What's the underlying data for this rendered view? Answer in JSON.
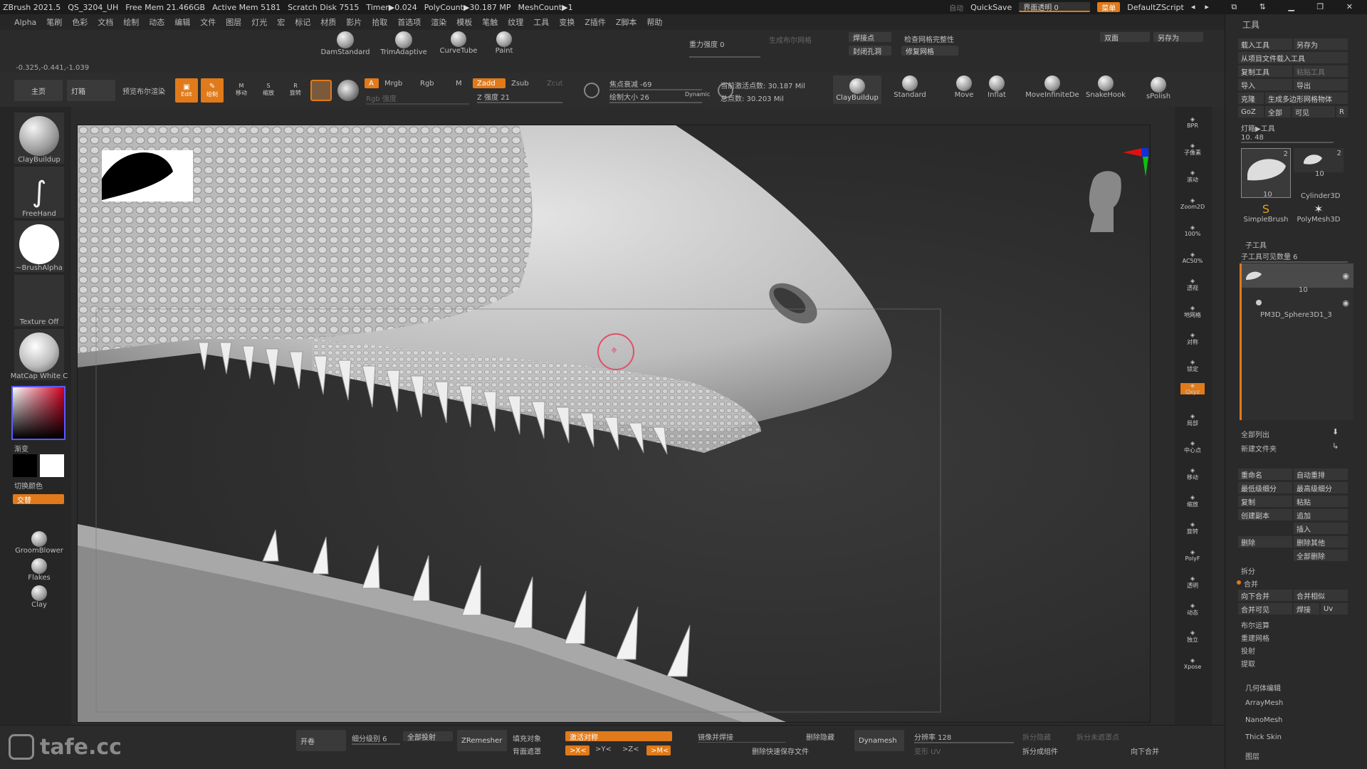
{
  "titlebar": {
    "app": "ZBrush 2021.5",
    "file": "QS_3204_UH",
    "free_mem": "Free Mem 21.466GB",
    "active_mem": "Active Mem 5181",
    "scratch": "Scratch Disk 7515",
    "timer": "Timer▶0.024",
    "polycount": "PolyCount▶30.187 MP",
    "meshcount": "MeshCount▶1",
    "autosave": "自动",
    "quicksave": "QuickSave",
    "ui_opacity": "界面透明 0",
    "menu_btn": "菜单",
    "script": "DefaultZScript"
  },
  "menubar": [
    "Alpha",
    "笔刷",
    "色彩",
    "文档",
    "绘制",
    "动态",
    "编辑",
    "文件",
    "图层",
    "灯光",
    "宏",
    "标记",
    "材质",
    "影片",
    "拾取",
    "首选项",
    "渲染",
    "模板",
    "笔触",
    "纹理",
    "工具",
    "变换",
    "Z插件",
    "Z脚本",
    "帮助"
  ],
  "coords": "-0.325,-0.441,-1.039",
  "top_brushes": [
    "DamStandard",
    "TrimAdaptive",
    "CurveTube",
    "Paint"
  ],
  "gravity": "重力强度 0",
  "top_right_btns": [
    "生成布尔网格",
    "焊接点",
    "检查网格完整性",
    "封闭孔洞",
    "修复网格",
    "双面",
    "另存为"
  ],
  "toolbar2": {
    "home": "主页",
    "lightbox": "灯箱",
    "preview_boolean": "预览布尔渲染",
    "edit": "Edit",
    "draw": "绘制",
    "move": "移动",
    "scale": "缩放",
    "rotate": "旋转",
    "a": "A",
    "mrgb": "Mrgb",
    "rgb": "Rgb",
    "m": "M",
    "rgb_intensity": "Rgb 强度",
    "zadd": "Zadd",
    "zsub": "Zsub",
    "zcut": "Zcut",
    "z_intensity": "Z 强度 21",
    "focal": "焦点衰减 -69",
    "draw_size": "绘制大小 26",
    "dynamic": "Dynamic",
    "active_points": "当前激活点数: 30.187 Mil",
    "total_points": "总点数: 30.203 Mil",
    "brushes": [
      "ClayBuildup",
      "Standard",
      "Move",
      "Inflat",
      "MoveInfiniteDe",
      "SnakeHook",
      "sPolish"
    ]
  },
  "leftshelf": {
    "brush": "ClayBuildup",
    "stroke": "FreeHand",
    "alpha": "~BrushAlpha",
    "texture": "Texture Off",
    "material": "MatCap White C",
    "gradient": "渐变",
    "switch_color": "切换颜色",
    "alternate": "交替",
    "brushes2": [
      "GroomBlower",
      "Flakes",
      "Clay"
    ]
  },
  "rightshelf": [
    "BPR",
    "子像素",
    "滚动",
    "Zoom2D",
    "100%",
    "AC50%",
    "透视",
    "地网格",
    "对称",
    "锁定",
    "Qxyz",
    "局部",
    "中心点",
    "移动",
    "缩放",
    "旋转",
    "PolyF",
    "透明",
    "动态",
    "独立",
    "Xpose"
  ],
  "toolpanel": {
    "title": "工具",
    "load": "载入工具",
    "save_as": "另存为",
    "load_project": "从项目文件载入工具",
    "copy_tool": "复制工具",
    "paste_tool": "粘贴工具",
    "import": "导入",
    "export": "导出",
    "clone": "克隆",
    "make_polymesh": "生成多边形网格物体",
    "goz": "GoZ",
    "all": "全部",
    "visible": "可见",
    "r": "R",
    "lightbox_tools": "灯箱▶工具",
    "count": "10. 48",
    "thumbs": [
      "SimpleBrush",
      "PolyMesh3D",
      "Cylinder3D"
    ],
    "thumb_nums": [
      "2",
      "10",
      "2",
      "10"
    ],
    "subtool_title": "子工具",
    "subtool_count": "子工具可见数量 6",
    "subtool_num": "10",
    "subtool_name": "PM3D_Sphere3D1_3",
    "list_all": "全部列出",
    "new_folder": "新建文件夹",
    "actions": [
      [
        "重命名",
        "自动重排"
      ],
      [
        "最低级细分",
        "最高级细分"
      ],
      [
        "复制",
        "粘贴"
      ],
      [
        "创建副本",
        "追加"
      ],
      [
        "",
        "插入"
      ],
      [
        "删除",
        "删除其他"
      ],
      [
        "",
        "全部删除"
      ]
    ],
    "split": "拆分",
    "merge": "合并",
    "merge_down": "向下合并",
    "merge_similar": "合并相似",
    "merge_visible": "合并可见",
    "weld": "焊接",
    "uv": "Uv",
    "boolean": "布尔运算",
    "remesh": "重建网格",
    "project": "投射",
    "extract": "提取",
    "sections": [
      "几何体编辑",
      "ArrayMesh",
      "NanoMesh",
      "Thick Skin",
      "图层"
    ]
  },
  "bottombar": {
    "open": "开卷",
    "subdiv": "细分级别 6",
    "all_proj": "全部投射",
    "zremesher": "ZRemesher",
    "fill_obj": "填充对象",
    "backface": "背面遮罩",
    "activate_sym": "激活对称",
    "x": ">X<",
    "y": ">Y<",
    "z": ">Z<",
    "m": ">M<",
    "mirror_weld": "镜像并焊接",
    "delete_hidden": "删除隐藏",
    "delete_history": "删除快速保存文件",
    "dynamesh": "Dynamesh",
    "resolution": "分辨率 128",
    "morph_uv": "变形 UV",
    "split_hidden": "拆分隐藏",
    "split_unmasked": "拆分未遮罩点",
    "split_groups": "拆分成组件",
    "merge_down": "向下合并"
  },
  "watermark": "tafe.cc"
}
